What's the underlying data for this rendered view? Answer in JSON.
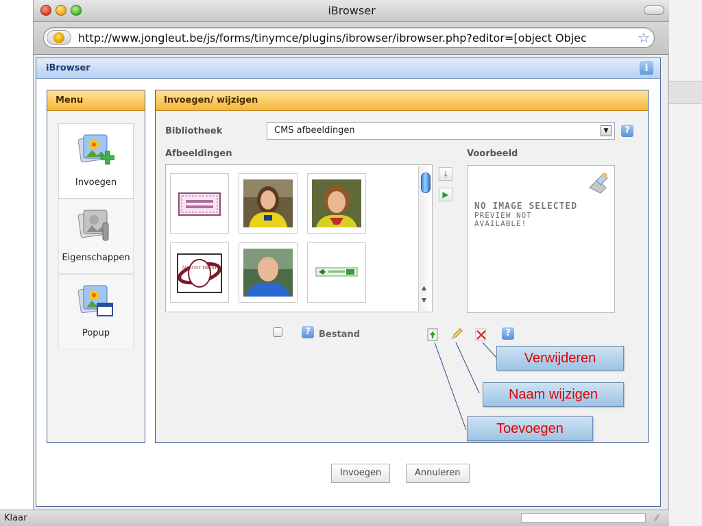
{
  "window": {
    "title": "iBrowser",
    "url": "http://www.jongleut.be/js/forms/tinymce/plugins/ibrowser/ibrowser.php?editor=[object Objec"
  },
  "dialog": {
    "title": "iBrowser"
  },
  "menu": {
    "header": "Menu",
    "items": [
      {
        "label": "Invoegen",
        "icon": "insert-image-icon"
      },
      {
        "label": "Eigenschappen",
        "icon": "image-properties-icon"
      },
      {
        "label": "Popup",
        "icon": "popup-image-icon"
      }
    ]
  },
  "main": {
    "header": "Invoegen/ wijzigen",
    "library_label": "Bibliotheek",
    "library_value": "CMS afbeeldingen",
    "images_label": "Afbeeldingen",
    "preview_label": "Voorbeeld",
    "preview_text_1": "NO IMAGE SELECTED",
    "preview_text_2": "PREVIEW NOT",
    "preview_text_3": "AVAILABLE!",
    "file_label": "Bestand",
    "help_symbol": "?"
  },
  "thumbnails": [
    {
      "kind": "stamp-logo"
    },
    {
      "kind": "portrait-woman-1"
    },
    {
      "kind": "portrait-woman-2"
    },
    {
      "kind": "ring-logo",
      "text": "AUGUST TRUST"
    },
    {
      "kind": "portrait-man"
    },
    {
      "kind": "banner-logo"
    }
  ],
  "callouts": {
    "delete": "Verwijderen",
    "rename": "Naam wijzigen",
    "add": "Toevoegen"
  },
  "buttons": {
    "insert": "Invoegen",
    "cancel": "Annuleren"
  },
  "status": {
    "text": "Klaar"
  },
  "colors": {
    "panel_header": "#f5b63a",
    "dialog_border": "#3a5a8c",
    "callout_text": "#e00000",
    "callout_bg": "#b5d3ec"
  }
}
